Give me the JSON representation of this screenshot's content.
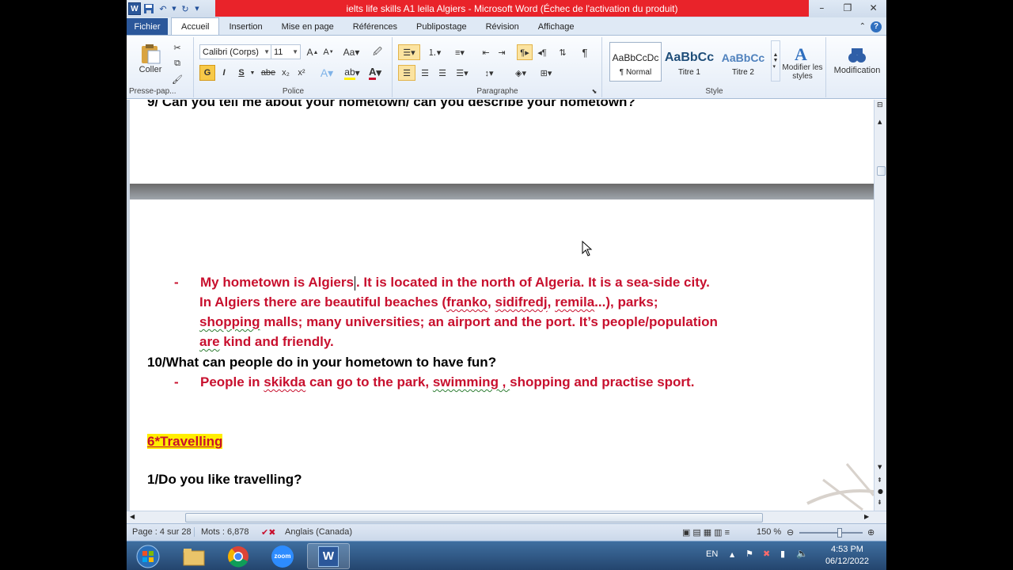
{
  "window": {
    "title": "ielts life skills A1 leila  Algiers  -  Microsoft Word (Échec de l'activation du produit)",
    "app_badge": "W"
  },
  "tabs": [
    "Fichier",
    "Accueil",
    "Insertion",
    "Mise en page",
    "Références",
    "Publipostage",
    "Révision",
    "Affichage"
  ],
  "ribbon": {
    "clipboard": {
      "paste_label": "Coller",
      "group_label": "Presse-pap..."
    },
    "font": {
      "family": "Calibri (Corps)",
      "size": "11",
      "bold": "G",
      "italic": "I",
      "underline": "S",
      "strike": "abe",
      "sub": "x₂",
      "sup": "x²",
      "group_label": "Police"
    },
    "paragraph": {
      "group_label": "Paragraphe"
    },
    "styles": {
      "items": [
        {
          "sample": "AaBbCcDc",
          "name": "¶ Normal"
        },
        {
          "sample": "AaBbCc",
          "name": "Titre 1"
        },
        {
          "sample": "AaBbCc",
          "name": "Titre 2"
        }
      ],
      "change_styles": "Modifier les styles",
      "group_label": "Style"
    },
    "editing": {
      "label": "Modification"
    }
  },
  "document": {
    "prev_page_line": "9/ Can you tell me about your hometown/ can you describe your hometown?",
    "bullet_dash": "-",
    "answer1_line1_before": "My hometown is Algiers",
    "answer1_line1_after": ". It is located in the north of Algeria. It is a sea-side city.",
    "answer1_line2_a": "In Algiers there are beautiful beaches (",
    "answer1_line2_franko": "franko",
    "answer1_line2_sep1": ", ",
    "answer1_line2_sidifredj": "sidifredj",
    "answer1_line2_sep2": ", ",
    "answer1_line2_remila": "remila",
    "answer1_line2_end": "...), parks;",
    "answer1_line3_shopping": "shopping",
    "answer1_line3_rest": " malls; many universities; an airport and the port. It’s people/population",
    "answer1_line4_are": "are",
    "answer1_line4_rest": " kind and friendly.",
    "question10": "10/What can people do in your hometown to have fun?",
    "answer2_a": "People in ",
    "answer2_skikda": "skikda",
    "answer2_b": " can go to the park, ",
    "answer2_swimming": "swimming , ",
    "answer2_c": "shopping and practise sport.",
    "heading": "6*Travelling",
    "question1": "1/Do you like travelling?"
  },
  "status": {
    "page": "Page : 4 sur 28",
    "words": "Mots : 6,878",
    "language": "Anglais (Canada)",
    "zoom": "150 %"
  },
  "taskbar": {
    "lang": "EN",
    "time": "4:53 PM",
    "date": "06/12/2022",
    "zoom_app_label": "zoom"
  }
}
